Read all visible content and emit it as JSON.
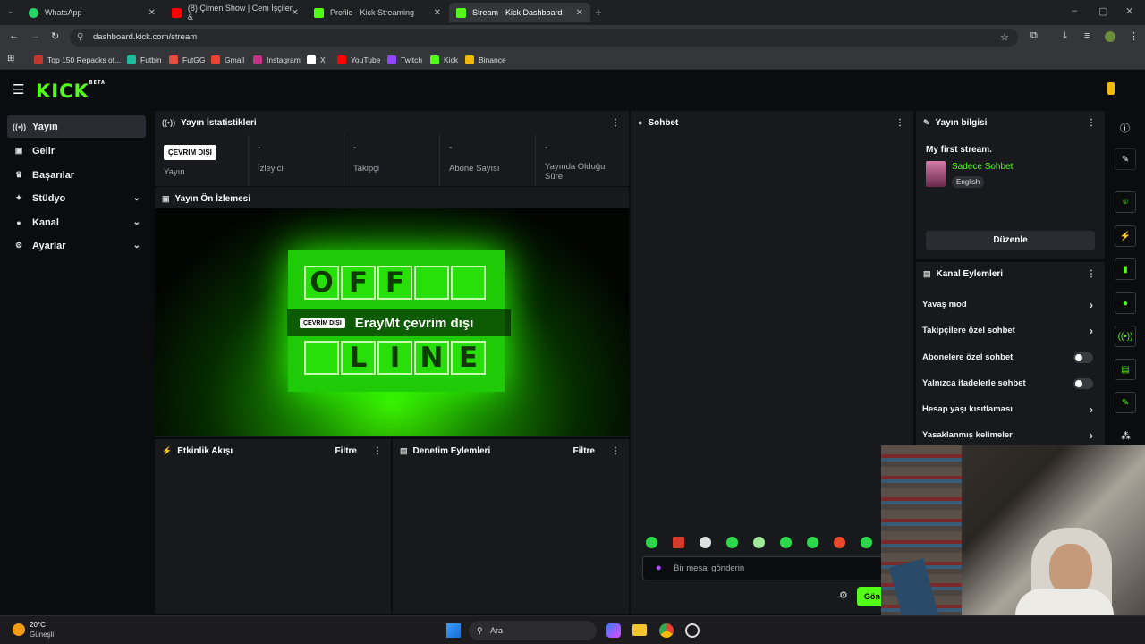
{
  "browser": {
    "tabs": [
      {
        "title": "WhatsApp",
        "color": "#25d366"
      },
      {
        "title": "(8) Çimen Show | Cem İşçiler &",
        "color": "#ff0000"
      },
      {
        "title": "Profile - Kick Streaming",
        "color": "#53fc18"
      },
      {
        "title": "Stream - Kick Dashboard",
        "color": "#53fc18"
      }
    ],
    "url": "dashboard.kick.com/stream",
    "bookmarks": [
      {
        "label": "Top 150 Repacks of...",
        "color": "#c0392b"
      },
      {
        "label": "Futbin",
        "color": "#1abc9c"
      },
      {
        "label": "FutGG",
        "color": "#e74c3c"
      },
      {
        "label": "Gmail",
        "color": "#ea4335"
      },
      {
        "label": "Instagram",
        "color": "#c13584"
      },
      {
        "label": "X",
        "color": "#ffffff"
      },
      {
        "label": "YouTube",
        "color": "#ff0000"
      },
      {
        "label": "Twitch",
        "color": "#9146ff"
      },
      {
        "label": "Kick",
        "color": "#53fc18"
      },
      {
        "label": "Binance",
        "color": "#f0b90b"
      }
    ]
  },
  "kick": {
    "logo": "KICK",
    "logo_tag": "BETA",
    "accent": "#53fc18"
  },
  "sidebar": {
    "items": [
      {
        "label": "Yayın",
        "icon": "broadcast-icon"
      },
      {
        "label": "Gelir",
        "icon": "wallet-icon"
      },
      {
        "label": "Başarılar",
        "icon": "trophy-icon"
      },
      {
        "label": "Stüdyo",
        "icon": "studio-icon"
      },
      {
        "label": "Kanal",
        "icon": "user-icon"
      },
      {
        "label": "Ayarlar",
        "icon": "gear-icon"
      }
    ]
  },
  "stats": {
    "title": "Yayın İstatistikleri",
    "status_badge": "ÇEVRIM DIŞI",
    "items": [
      {
        "label": "Yayın",
        "value": ""
      },
      {
        "label": "İzleyici",
        "value": "-"
      },
      {
        "label": "Takipçi",
        "value": "-"
      },
      {
        "label": "Abone Sayısı",
        "value": "-"
      },
      {
        "label": "Yayında Olduğu Süre",
        "value": "-"
      }
    ]
  },
  "preview": {
    "title": "Yayın Ön İzlemesi",
    "badge": "ÇEVRİM DIŞI",
    "message": "ErayMt çevrim dışı",
    "board_letters_top": [
      "O",
      "F",
      "F",
      "",
      ""
    ],
    "board_letters_bottom": [
      "",
      "L",
      "I",
      "N",
      "E"
    ]
  },
  "activity": {
    "title": "Etkinlik Akışı",
    "filter": "Filtre"
  },
  "moderation": {
    "title": "Denetim Eylemleri",
    "filter": "Filtre"
  },
  "chat": {
    "title": "Sohbet",
    "placeholder": "Bir mesaj gönderin",
    "send": "Gön"
  },
  "stream_info": {
    "title": "Yayın bilgisi",
    "stream_title": "My first stream.",
    "category": "Sadece Sohbet",
    "language": "English",
    "edit_button": "Düzenle"
  },
  "channel_actions": {
    "title": "Kanal Eylemleri",
    "items": [
      {
        "label": "Yavaş mod",
        "kind": "arrow"
      },
      {
        "label": "Takipçilere özel sohbet",
        "kind": "arrow"
      },
      {
        "label": "Abonelere özel sohbet",
        "kind": "toggle",
        "on": false
      },
      {
        "label": "Yalnızca ifadelerle sohbet",
        "kind": "toggle",
        "on": false
      },
      {
        "label": "Hesap yaşı kısıtlaması",
        "kind": "arrow"
      },
      {
        "label": "Yasaklanmış kelimeler",
        "kind": "arrow"
      }
    ]
  },
  "taskbar": {
    "weather_temp": "20°C",
    "weather_desc": "Güneşli",
    "search": "Ara"
  }
}
